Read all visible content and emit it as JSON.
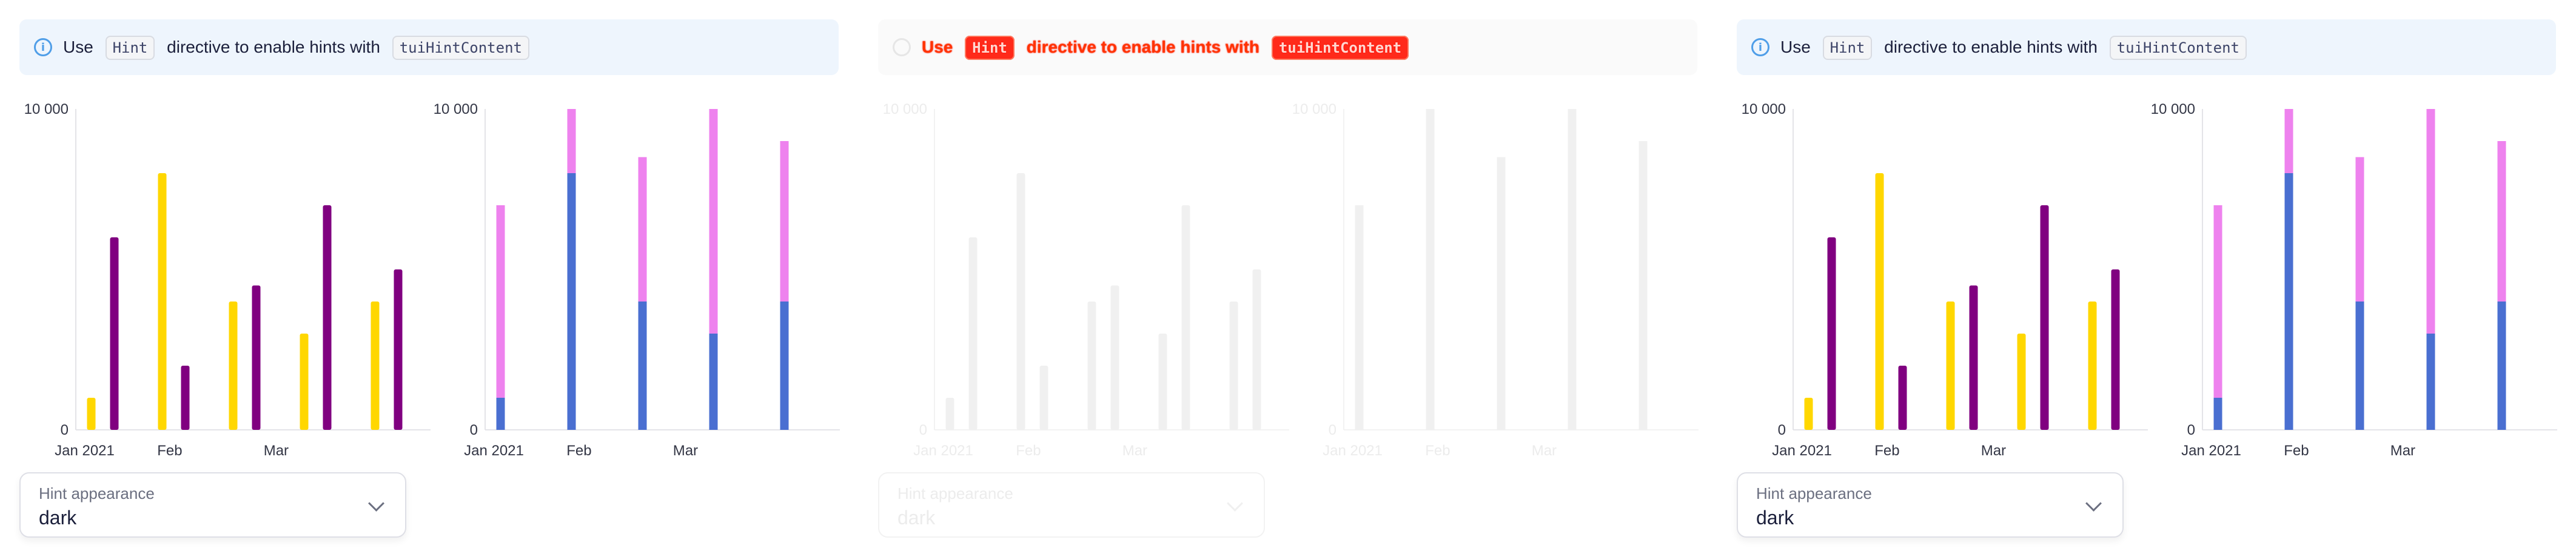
{
  "notice": {
    "prefix": "Use",
    "code1": "Hint",
    "middle": "directive to enable hints with",
    "code2": "tuiHintContent"
  },
  "select": {
    "label": "Hint appearance",
    "value": "dark"
  },
  "chart_data": [
    {
      "type": "bar",
      "categories": [
        "Jan 2021",
        "Feb",
        "Mar"
      ],
      "x_tick_labels": [
        "Jan 2021",
        "Feb",
        "Mar"
      ],
      "ylim": [
        0,
        10000
      ],
      "y_tick_labels": [
        "10 000",
        "0"
      ],
      "series": [
        {
          "values": [
            1000,
            8000,
            4000,
            3000,
            4000
          ],
          "color": "#ffd700"
        },
        {
          "values": [
            6000,
            2000,
            4500,
            7000,
            5000
          ],
          "color": "#800080"
        }
      ],
      "layout": "grouped"
    },
    {
      "type": "bar",
      "categories": [
        "Jan 2021",
        "Feb",
        "Mar"
      ],
      "x_tick_labels": [
        "Jan 2021",
        "Feb",
        "Mar"
      ],
      "ylim": [
        0,
        10000
      ],
      "y_tick_labels": [
        "10 000",
        "0"
      ],
      "series": [
        {
          "values": [
            1000,
            8000,
            4000,
            3000,
            4000
          ],
          "color": "#4a6fd1"
        },
        {
          "values": [
            6000,
            2000,
            4500,
            7000,
            5000
          ],
          "color": "#ee82ee"
        }
      ],
      "layout": "stacked"
    }
  ],
  "colors": {
    "accent": "#4f9ee8",
    "disabled_bar": "#f0f0f0"
  },
  "panels": [
    {
      "state": "enabled"
    },
    {
      "state": "disabled"
    },
    {
      "state": "enabled"
    }
  ]
}
